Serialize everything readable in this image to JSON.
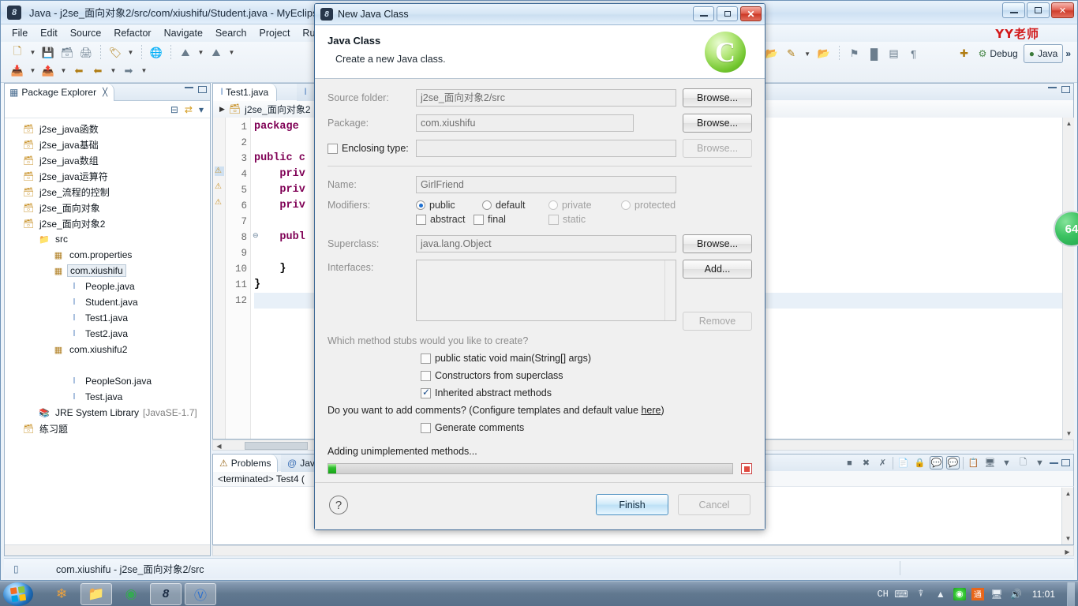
{
  "window": {
    "title": "Java - j2se_面向对象2/src/com/xiushifu/Student.java - MyEclipse",
    "watermark": "YY老师",
    "minimize": "–",
    "maximize": "□",
    "close": "✕"
  },
  "menu": [
    "File",
    "Edit",
    "Source",
    "Refactor",
    "Navigate",
    "Search",
    "Project",
    "Run"
  ],
  "toolbar": {
    "row1": [
      "new-icon",
      "new-dropdown",
      "save-icon",
      "save-all-icon",
      "print-icon",
      "sep",
      "new-java-project-icon",
      "new-java-dropdown",
      "sep",
      "web20-icon",
      "sep",
      "deploy-icon",
      "deploy-dropdown",
      "server-icon",
      "server-dropdown"
    ],
    "row2": [
      "import-icon",
      "import-dropdown",
      "export-icon",
      "export-dropdown",
      "back-star-icon",
      "back-icon",
      "back-dropdown",
      "forward-icon",
      "forward-dropdown"
    ],
    "right_icons": [
      "open-resource-icon",
      "search-icon",
      "search-dropdown",
      "open-type-icon",
      "sep",
      "next-annotation-icon",
      "run-icon",
      "console-icon",
      "format-icon"
    ],
    "open_perspective_label": "",
    "debug_label": "Debug",
    "java_label": "Java",
    "more_label": "»"
  },
  "package_explorer": {
    "tab_label": "Package Explorer",
    "close_glyph": "╳",
    "toolbar_icons": [
      "collapse-all-icon",
      "link-with-editor-icon",
      "view-menu-icon"
    ],
    "tree": [
      {
        "label": "j2se_java函数",
        "icon": "project-icon",
        "indent": 0,
        "selected": false
      },
      {
        "label": "j2se_java基础",
        "icon": "project-icon",
        "indent": 0,
        "selected": false
      },
      {
        "label": "j2se_java数组",
        "icon": "project-icon",
        "indent": 0,
        "selected": false
      },
      {
        "label": "j2se_java运算符",
        "icon": "project-icon",
        "indent": 0,
        "selected": false
      },
      {
        "label": "j2se_流程的控制",
        "icon": "project-icon",
        "indent": 0,
        "selected": false
      },
      {
        "label": "j2se_面向对象",
        "icon": "project-icon",
        "indent": 0,
        "selected": false
      },
      {
        "label": "j2se_面向对象2",
        "icon": "project-icon",
        "indent": 0,
        "selected": false
      },
      {
        "label": "src",
        "icon": "source-folder-icon",
        "indent": 1,
        "selected": false
      },
      {
        "label": "com.properties",
        "icon": "package-icon",
        "indent": 2,
        "selected": false
      },
      {
        "label": "com.xiushifu",
        "icon": "package-icon",
        "indent": 2,
        "selected": true
      },
      {
        "label": "People.java",
        "icon": "java-file-icon",
        "indent": 3,
        "selected": false
      },
      {
        "label": "Student.java",
        "icon": "java-file-warning-icon",
        "indent": 3,
        "selected": false
      },
      {
        "label": "Test1.java",
        "icon": "java-file-warning-icon",
        "indent": 3,
        "selected": false
      },
      {
        "label": "Test2.java",
        "icon": "java-file-warning-icon",
        "indent": 3,
        "selected": false
      },
      {
        "label": "com.xiushifu2",
        "icon": "package-icon",
        "indent": 2,
        "selected": false
      },
      {
        "label": "",
        "icon": "",
        "indent": 2,
        "selected": false
      },
      {
        "label": "PeopleSon.java",
        "icon": "java-file-icon",
        "indent": 3,
        "selected": false
      },
      {
        "label": "Test.java",
        "icon": "java-file-warning-icon",
        "indent": 3,
        "selected": false
      },
      {
        "label": "JRE System Library",
        "suffix": "[JavaSE-1.7]",
        "icon": "jre-library-icon",
        "indent": 2,
        "selected": false
      },
      {
        "label": "练习题",
        "icon": "project-icon",
        "indent": 0,
        "selected": false
      }
    ]
  },
  "editor": {
    "tabs": [
      {
        "label": "Test1.java",
        "active": true
      },
      {
        "label": "",
        "active": false
      }
    ],
    "breadcrumb": "j2se_面向对象2",
    "line_numbers": [
      "1",
      "2",
      "3",
      "4",
      "5",
      "6",
      "7",
      "8",
      "9",
      "10",
      "11",
      "12"
    ],
    "code_lines": [
      "package ",
      "",
      "public c",
      "    priv",
      "    priv",
      "    priv",
      "",
      "    publ",
      "",
      "    }",
      "}",
      ""
    ]
  },
  "bottom_panel": {
    "tabs": [
      {
        "label": "Problems",
        "active": true
      },
      {
        "label": "Java",
        "active": false
      }
    ],
    "console_header": "<terminated> Test4 (",
    "tool_icons": [
      "terminate-icon",
      "remove-launch-icon",
      "remove-all-terminated-icon",
      "clear-console-icon",
      "scroll-lock-icon",
      "pin-console-icon",
      "display-selected-console-icon",
      "open-console-icon",
      "new-console-view-icon",
      "new-console-dropdown"
    ]
  },
  "statusbar": {
    "icon": "writable-icon",
    "text": "com.xiushifu - j2se_面向对象2/src"
  },
  "badge": {
    "text": "64"
  },
  "dialog": {
    "title": "New Java Class",
    "heading": "Java Class",
    "subheading": "Create a new Java class.",
    "logo_letter": "C",
    "fields": {
      "source_folder_label": "Source folder:",
      "source_folder_value": "j2se_面向对象2/src",
      "package_label": "Package:",
      "package_value": "com.xiushifu",
      "enclosing_type_label": "Enclosing type:",
      "enclosing_type_value": "",
      "name_label": "Name:",
      "name_value": "GirlFriend",
      "modifiers_label": "Modifiers:",
      "superclass_label": "Superclass:",
      "superclass_value": "java.lang.Object",
      "interfaces_label": "Interfaces:"
    },
    "buttons": {
      "browse1": "Browse...",
      "browse2": "Browse...",
      "browse3": "Browse...",
      "browse4": "Browse...",
      "add": "Add...",
      "remove": "Remove",
      "finish": "Finish",
      "cancel": "Cancel",
      "help": "?"
    },
    "modifiers": [
      {
        "label": "public",
        "selected": true,
        "enabled": true
      },
      {
        "label": "default",
        "selected": false,
        "enabled": true
      },
      {
        "label": "private",
        "selected": false,
        "enabled": false
      },
      {
        "label": "protected",
        "selected": false,
        "enabled": false
      }
    ],
    "modifier_flags": [
      {
        "label": "abstract",
        "checked": false,
        "enabled": true
      },
      {
        "label": "final",
        "checked": false,
        "enabled": true
      },
      {
        "label": "static",
        "checked": false,
        "enabled": false
      }
    ],
    "stubs_question": "Which method stubs would you like to create?",
    "stubs": [
      {
        "label": "public static void main(String[] args)",
        "checked": false
      },
      {
        "label": "Constructors from superclass",
        "checked": false
      },
      {
        "label": "Inherited abstract methods",
        "checked": true
      }
    ],
    "comments_question_pre": "Do you want to add comments? (Configure templates and default value ",
    "comments_link": "here",
    "comments_question_post": ")",
    "generate_comments_label": "Generate comments",
    "generate_comments_checked": false,
    "progress_label": "Adding unimplemented methods...",
    "progress_percent": 2,
    "progress_color": "#2fbf2f"
  },
  "taskbar": {
    "apps": [
      "windows-media-icon",
      "file-explorer-icon",
      "chrome-icon",
      "myeclipse-icon",
      "wps-icon"
    ],
    "tray": {
      "ime": "CH",
      "keyboard_icon": "keyboard-icon",
      "overflow_icon": "show-hidden-icons-icon",
      "up_arrow": "▲",
      "icons": [
        "network-shield-icon",
        "ime-toolbar-icon",
        "network-icon",
        "volume-icon"
      ],
      "clock": "11:01",
      "ime_badge": "通"
    }
  }
}
